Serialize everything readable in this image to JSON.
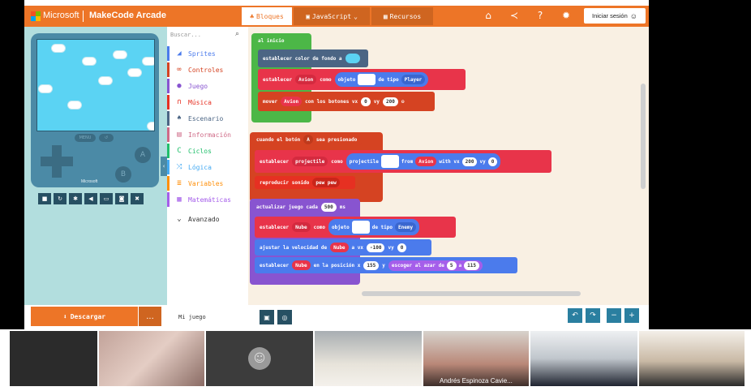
{
  "header": {
    "ms_label": "Microsoft",
    "app_title": "MakeCode Arcade",
    "tabs": [
      {
        "label": "Bloques",
        "icon": "puzzle-icon"
      },
      {
        "label": "JavaScript",
        "icon": "code-icon"
      },
      {
        "label": "Recursos",
        "icon": "images-icon"
      }
    ],
    "icons": [
      "home-icon",
      "share-icon",
      "help-icon",
      "gear-icon"
    ],
    "signin_label": "Iniciar sesión"
  },
  "simulator": {
    "menu_label": "MENU",
    "a_label": "A",
    "b_label": "B",
    "ms_label": "Microsoft",
    "controls": [
      "stop-icon",
      "restart-icon",
      "debug-icon",
      "volume-icon",
      "keyboard-icon",
      "screenshot-icon",
      "fullscreen-icon"
    ]
  },
  "toolbox": {
    "search_placeholder": "Buscar...",
    "categories": [
      {
        "label": "Sprites",
        "color": "#4b7bec",
        "icon": "send-icon"
      },
      {
        "label": "Controles",
        "color": "#d54322",
        "icon": "gamepad-icon"
      },
      {
        "label": "Juego",
        "color": "#8854d0",
        "icon": "circle-icon"
      },
      {
        "label": "Música",
        "color": "#e63022",
        "icon": "headphones-icon"
      },
      {
        "label": "Escenario",
        "color": "#4b6584",
        "icon": "tree-icon"
      },
      {
        "label": "Información",
        "color": "#cf6a87",
        "icon": "id-card-icon"
      },
      {
        "label": "Ciclos",
        "color": "#20bf6b",
        "icon": "loop-icon"
      },
      {
        "label": "Lógica",
        "color": "#45aaf2",
        "icon": "shuffle-icon"
      },
      {
        "label": "Variables",
        "color": "#ff8f08",
        "icon": "list-icon"
      },
      {
        "label": "Matemáticas",
        "color": "#a55eea",
        "icon": "calculator-icon"
      },
      {
        "label": "Avanzado",
        "color": "#333333",
        "icon": "chevron-down-icon"
      }
    ]
  },
  "blocks": {
    "on_start": "al inicio",
    "set_bg": "establecer color de fondo a",
    "set_avion_1": "establecer",
    "avion_var": "Avion",
    "como": "como",
    "objeto": "objeto",
    "de_tipo": "de tipo",
    "player_kind": "Player",
    "mover": "mover",
    "con_botones": "con los botones vx",
    "vx_val": "0",
    "vy": "vy",
    "vy_val": "200",
    "on_button": "cuando el botón",
    "button_a": "A",
    "sea_presionado": "sea presionado",
    "set_projectile": "establecer",
    "projectile_var": "projectile",
    "projectile_fn": "projectile",
    "from": "from",
    "with_vx": "with vx",
    "proj_vx": "200",
    "vy2": "vy",
    "proj_vy": "0",
    "play_sound": "reproducir sonido",
    "sound_name": "pew pew",
    "update_every": "actualizar juego cada",
    "update_ms": "500",
    "ms": "ms",
    "set_nube": "establecer",
    "nube_var": "Nube",
    "enemy_kind": "Enemy",
    "adjust_vel": "ajustar la velocidad de",
    "a_vx": "a vx",
    "nube_vx": "-100",
    "nube_vy": "0",
    "set_pos": "establecer",
    "en_posicion": "en la posición x",
    "pos_x": "155",
    "y": "y",
    "random": "escoger al azar de",
    "rand_from": "5",
    "a": "a",
    "rand_to": "115"
  },
  "bottom": {
    "download_label": "Descargar",
    "more_label": "...",
    "project_name": "Mi juego"
  },
  "video": {
    "participant_label": "Andrés Espinoza Cavie..."
  }
}
